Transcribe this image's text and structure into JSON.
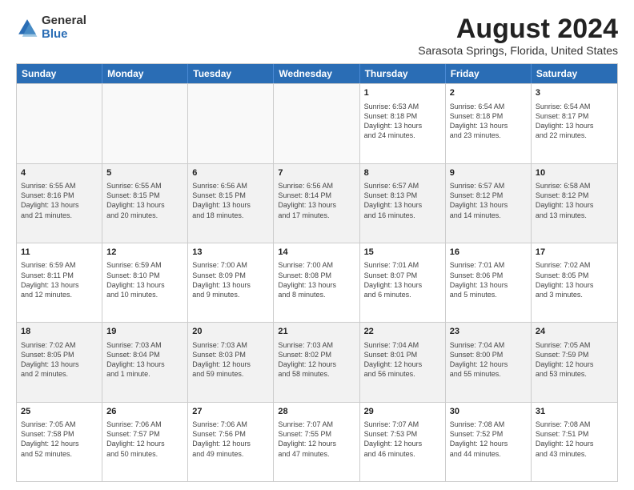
{
  "logo": {
    "general": "General",
    "blue": "Blue"
  },
  "title": "August 2024",
  "subtitle": "Sarasota Springs, Florida, United States",
  "header_days": [
    "Sunday",
    "Monday",
    "Tuesday",
    "Wednesday",
    "Thursday",
    "Friday",
    "Saturday"
  ],
  "rows": [
    [
      {
        "day": "",
        "empty": true
      },
      {
        "day": "",
        "empty": true
      },
      {
        "day": "",
        "empty": true
      },
      {
        "day": "",
        "empty": true
      },
      {
        "day": "1",
        "lines": [
          "Sunrise: 6:53 AM",
          "Sunset: 8:18 PM",
          "Daylight: 13 hours",
          "and 24 minutes."
        ]
      },
      {
        "day": "2",
        "lines": [
          "Sunrise: 6:54 AM",
          "Sunset: 8:18 PM",
          "Daylight: 13 hours",
          "and 23 minutes."
        ]
      },
      {
        "day": "3",
        "lines": [
          "Sunrise: 6:54 AM",
          "Sunset: 8:17 PM",
          "Daylight: 13 hours",
          "and 22 minutes."
        ]
      }
    ],
    [
      {
        "day": "4",
        "lines": [
          "Sunrise: 6:55 AM",
          "Sunset: 8:16 PM",
          "Daylight: 13 hours",
          "and 21 minutes."
        ]
      },
      {
        "day": "5",
        "lines": [
          "Sunrise: 6:55 AM",
          "Sunset: 8:15 PM",
          "Daylight: 13 hours",
          "and 20 minutes."
        ]
      },
      {
        "day": "6",
        "lines": [
          "Sunrise: 6:56 AM",
          "Sunset: 8:15 PM",
          "Daylight: 13 hours",
          "and 18 minutes."
        ]
      },
      {
        "day": "7",
        "lines": [
          "Sunrise: 6:56 AM",
          "Sunset: 8:14 PM",
          "Daylight: 13 hours",
          "and 17 minutes."
        ]
      },
      {
        "day": "8",
        "lines": [
          "Sunrise: 6:57 AM",
          "Sunset: 8:13 PM",
          "Daylight: 13 hours",
          "and 16 minutes."
        ]
      },
      {
        "day": "9",
        "lines": [
          "Sunrise: 6:57 AM",
          "Sunset: 8:12 PM",
          "Daylight: 13 hours",
          "and 14 minutes."
        ]
      },
      {
        "day": "10",
        "lines": [
          "Sunrise: 6:58 AM",
          "Sunset: 8:12 PM",
          "Daylight: 13 hours",
          "and 13 minutes."
        ]
      }
    ],
    [
      {
        "day": "11",
        "lines": [
          "Sunrise: 6:59 AM",
          "Sunset: 8:11 PM",
          "Daylight: 13 hours",
          "and 12 minutes."
        ]
      },
      {
        "day": "12",
        "lines": [
          "Sunrise: 6:59 AM",
          "Sunset: 8:10 PM",
          "Daylight: 13 hours",
          "and 10 minutes."
        ]
      },
      {
        "day": "13",
        "lines": [
          "Sunrise: 7:00 AM",
          "Sunset: 8:09 PM",
          "Daylight: 13 hours",
          "and 9 minutes."
        ]
      },
      {
        "day": "14",
        "lines": [
          "Sunrise: 7:00 AM",
          "Sunset: 8:08 PM",
          "Daylight: 13 hours",
          "and 8 minutes."
        ]
      },
      {
        "day": "15",
        "lines": [
          "Sunrise: 7:01 AM",
          "Sunset: 8:07 PM",
          "Daylight: 13 hours",
          "and 6 minutes."
        ]
      },
      {
        "day": "16",
        "lines": [
          "Sunrise: 7:01 AM",
          "Sunset: 8:06 PM",
          "Daylight: 13 hours",
          "and 5 minutes."
        ]
      },
      {
        "day": "17",
        "lines": [
          "Sunrise: 7:02 AM",
          "Sunset: 8:05 PM",
          "Daylight: 13 hours",
          "and 3 minutes."
        ]
      }
    ],
    [
      {
        "day": "18",
        "lines": [
          "Sunrise: 7:02 AM",
          "Sunset: 8:05 PM",
          "Daylight: 13 hours",
          "and 2 minutes."
        ]
      },
      {
        "day": "19",
        "lines": [
          "Sunrise: 7:03 AM",
          "Sunset: 8:04 PM",
          "Daylight: 13 hours",
          "and 1 minute."
        ]
      },
      {
        "day": "20",
        "lines": [
          "Sunrise: 7:03 AM",
          "Sunset: 8:03 PM",
          "Daylight: 12 hours",
          "and 59 minutes."
        ]
      },
      {
        "day": "21",
        "lines": [
          "Sunrise: 7:03 AM",
          "Sunset: 8:02 PM",
          "Daylight: 12 hours",
          "and 58 minutes."
        ]
      },
      {
        "day": "22",
        "lines": [
          "Sunrise: 7:04 AM",
          "Sunset: 8:01 PM",
          "Daylight: 12 hours",
          "and 56 minutes."
        ]
      },
      {
        "day": "23",
        "lines": [
          "Sunrise: 7:04 AM",
          "Sunset: 8:00 PM",
          "Daylight: 12 hours",
          "and 55 minutes."
        ]
      },
      {
        "day": "24",
        "lines": [
          "Sunrise: 7:05 AM",
          "Sunset: 7:59 PM",
          "Daylight: 12 hours",
          "and 53 minutes."
        ]
      }
    ],
    [
      {
        "day": "25",
        "lines": [
          "Sunrise: 7:05 AM",
          "Sunset: 7:58 PM",
          "Daylight: 12 hours",
          "and 52 minutes."
        ]
      },
      {
        "day": "26",
        "lines": [
          "Sunrise: 7:06 AM",
          "Sunset: 7:57 PM",
          "Daylight: 12 hours",
          "and 50 minutes."
        ]
      },
      {
        "day": "27",
        "lines": [
          "Sunrise: 7:06 AM",
          "Sunset: 7:56 PM",
          "Daylight: 12 hours",
          "and 49 minutes."
        ]
      },
      {
        "day": "28",
        "lines": [
          "Sunrise: 7:07 AM",
          "Sunset: 7:55 PM",
          "Daylight: 12 hours",
          "and 47 minutes."
        ]
      },
      {
        "day": "29",
        "lines": [
          "Sunrise: 7:07 AM",
          "Sunset: 7:53 PM",
          "Daylight: 12 hours",
          "and 46 minutes."
        ]
      },
      {
        "day": "30",
        "lines": [
          "Sunrise: 7:08 AM",
          "Sunset: 7:52 PM",
          "Daylight: 12 hours",
          "and 44 minutes."
        ]
      },
      {
        "day": "31",
        "lines": [
          "Sunrise: 7:08 AM",
          "Sunset: 7:51 PM",
          "Daylight: 12 hours",
          "and 43 minutes."
        ]
      }
    ]
  ]
}
